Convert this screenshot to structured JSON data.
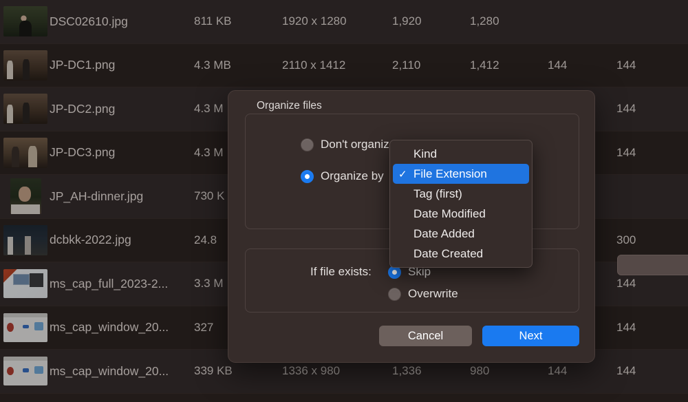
{
  "file_table": {
    "columns": [
      "thumbnail",
      "name",
      "size",
      "dimensions",
      "width",
      "height",
      "dpi_x",
      "dpi_y"
    ],
    "rows": [
      {
        "name": "DSC02610.jpg",
        "size": "811 KB",
        "dimensions": "1920 x 1280",
        "width": "1,920",
        "height": "1,280",
        "dpi_x": "",
        "dpi_y": ""
      },
      {
        "name": "JP-DC1.png",
        "size": "4.3 MB",
        "dimensions": "2110 x 1412",
        "width": "2,110",
        "height": "1,412",
        "dpi_x": "144",
        "dpi_y": "144"
      },
      {
        "name": "JP-DC2.png",
        "size": "4.3 M",
        "dimensions": "",
        "width": "",
        "height": "",
        "dpi_x": "",
        "dpi_y": "144"
      },
      {
        "name": "JP-DC3.png",
        "size": "4.3 M",
        "dimensions": "",
        "width": "",
        "height": "",
        "dpi_x": "",
        "dpi_y": "144"
      },
      {
        "name": "JP_AH-dinner.jpg",
        "size": "730 K",
        "dimensions": "",
        "width": "",
        "height": "",
        "dpi_x": "",
        "dpi_y": ""
      },
      {
        "name": "dcbkk-2022.jpg",
        "size": "24.8",
        "dimensions": "",
        "width": "",
        "height": "",
        "dpi_x": "",
        "dpi_y": "300"
      },
      {
        "name": "ms_cap_full_2023-2...",
        "size": "3.3 M",
        "dimensions": "",
        "width": "",
        "height": "",
        "dpi_x": "",
        "dpi_y": "144"
      },
      {
        "name": "ms_cap_window_20...",
        "size": "327 ",
        "dimensions": "",
        "width": "",
        "height": "",
        "dpi_x": "",
        "dpi_y": "144"
      },
      {
        "name": "ms_cap_window_20...",
        "size": "339 KB",
        "dimensions": "1336 x 980",
        "width": "1,336",
        "height": "980",
        "dpi_x": "144",
        "dpi_y": "144"
      }
    ]
  },
  "dialog": {
    "title": "Organize files",
    "organize_options": [
      {
        "label": "Don't organize",
        "selected": false
      },
      {
        "label": "Organize by",
        "selected": true
      }
    ],
    "if_file_exists_label": "If file exists:",
    "exists_options": [
      {
        "label": "Skip",
        "selected": true
      },
      {
        "label": "Overwrite",
        "selected": false
      }
    ],
    "buttons": {
      "cancel": "Cancel",
      "next": "Next"
    }
  },
  "dropdown": {
    "selected": "File Extension",
    "check_glyph": "✓",
    "items": [
      "Kind",
      "File Extension",
      "Tag (first)",
      "Date Modified",
      "Date Added",
      "Date Created"
    ]
  },
  "colors": {
    "accent": "#1a7af0",
    "menu_highlight": "#1f74e0",
    "dialog_bg": "#362c2a",
    "window_bg": "#221b19",
    "cancel_button": "#6c605c"
  }
}
